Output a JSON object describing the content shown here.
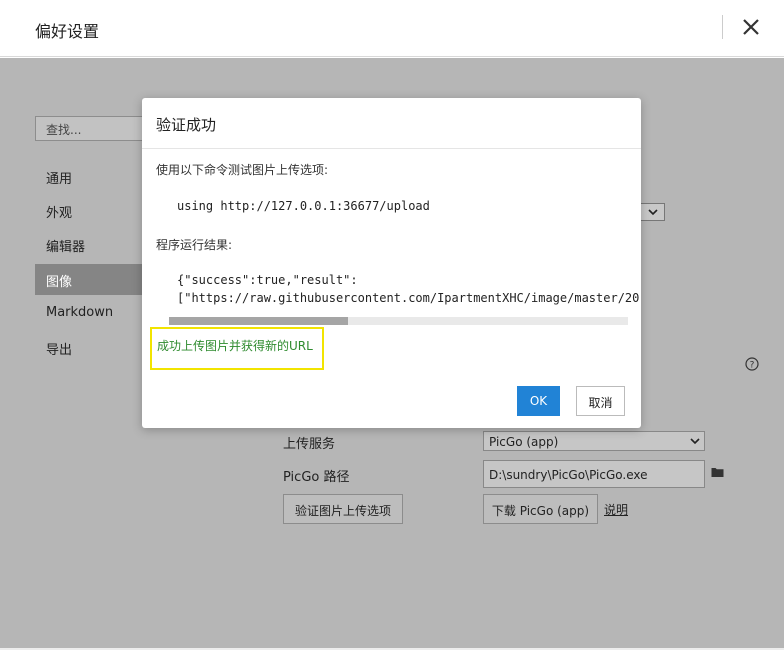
{
  "window": {
    "title": "偏好设置"
  },
  "sidebar": {
    "search_placeholder": "查找...",
    "items": [
      {
        "label": "通用",
        "active": false
      },
      {
        "label": "外观",
        "active": false
      },
      {
        "label": "编辑器",
        "active": false
      },
      {
        "label": "图像",
        "active": true
      },
      {
        "label": "Markdown",
        "active": false
      },
      {
        "label": "导出",
        "active": false
      }
    ]
  },
  "upload": {
    "service_label": "上传服务",
    "service_value": "PicGo (app)",
    "path_label": "PicGo 路径",
    "path_value": "D:\\sundry\\PicGo\\PicGo.exe",
    "verify_button": "验证图片上传选项",
    "download_button": "下载 PicGo (app)",
    "help_link": "说明"
  },
  "modal": {
    "title": "验证成功",
    "command_intro": "使用以下命令测试图片上传选项:",
    "command": "using http://127.0.0.1:36677/upload",
    "result_intro": "程序运行结果:",
    "result_line1": "{\"success\":true,\"result\":",
    "result_line2": "[\"https://raw.githubusercontent.com/IpartmentXHC/image/master/20",
    "horizontal_scroll_fraction": 0.39,
    "success_message": "成功上传图片并获得新的URL",
    "ok_label": "OK",
    "cancel_label": "取消"
  },
  "colors": {
    "primary": "#2183d6",
    "success": "#2e8b2e",
    "highlight": "#f2e400"
  },
  "icons": [
    "close-icon",
    "chevron-down-icon",
    "help-icon",
    "folder-icon"
  ]
}
